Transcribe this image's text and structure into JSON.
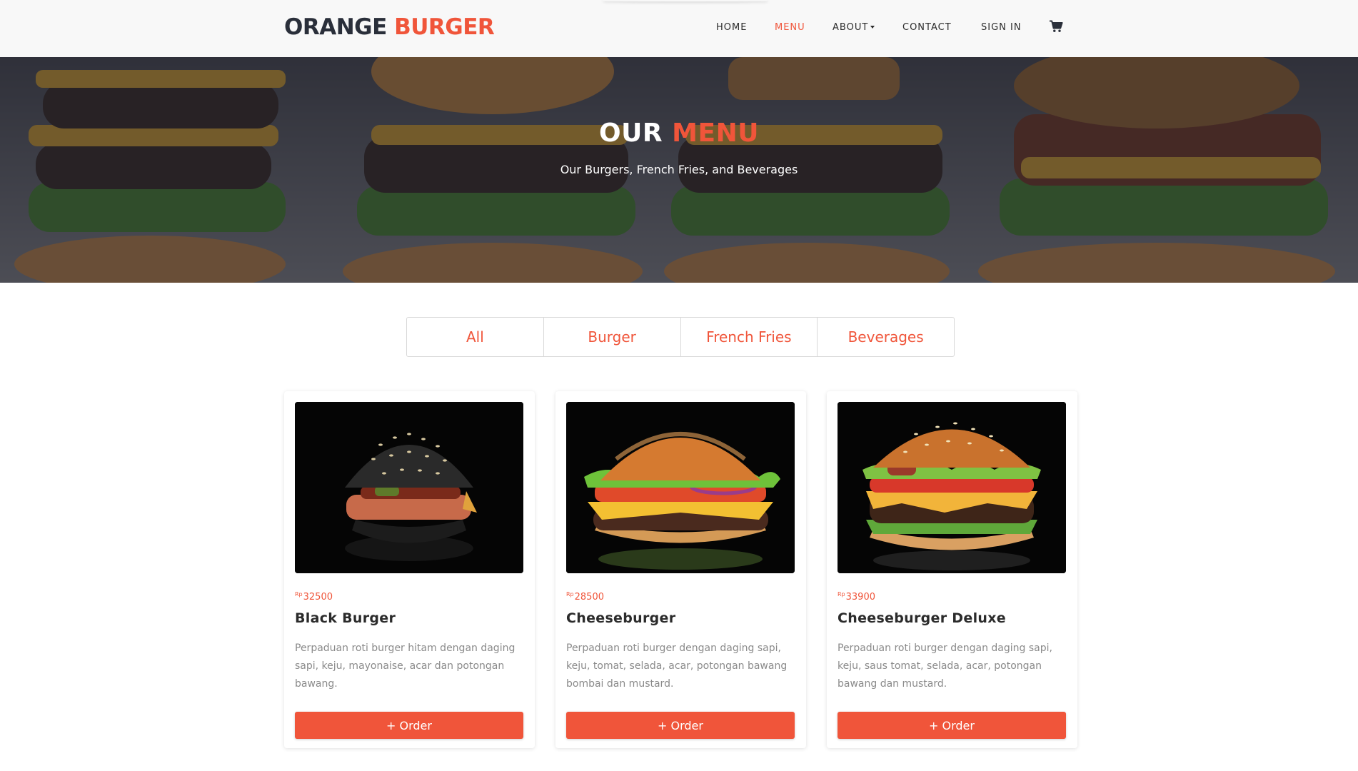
{
  "navbar": {
    "brand_part1": "ORANGE",
    "brand_part2": "BURGER",
    "items": [
      {
        "label": "HOME"
      },
      {
        "label": "MENU"
      },
      {
        "label": "ABOUT"
      },
      {
        "label": "CONTACT"
      },
      {
        "label": "SIGN IN"
      }
    ],
    "active_item": "MENU",
    "cart_icon": "shopping-cart-icon"
  },
  "hero": {
    "title_part1": "OUR",
    "title_part2": "MENU",
    "subtitle": "Our Burgers, French Fries, and Beverages"
  },
  "filters": {
    "tabs": [
      {
        "label": "All"
      },
      {
        "label": "Burger"
      },
      {
        "label": "French Fries"
      },
      {
        "label": "Beverages"
      }
    ]
  },
  "menu": {
    "currency": "Rp",
    "items": [
      {
        "price": "32500",
        "name": "Black Burger",
        "description": "Perpaduan roti burger hitam dengan daging sapi, keju, mayonaise, acar dan potongan bawang.",
        "order_label": "+ Order"
      },
      {
        "price": "28500",
        "name": "Cheeseburger",
        "description": "Perpaduan roti burger dengan daging sapi, keju, tomat, selada, acar, potongan bawang bombai dan mustard.",
        "order_label": "+ Order"
      },
      {
        "price": "33900",
        "name": "Cheeseburger Deluxe",
        "description": "Perpaduan roti burger dengan daging sapi, keju, saus tomat, selada, acar, potongan bawang dan mustard.",
        "order_label": "+ Order"
      }
    ]
  },
  "colors": {
    "accent": "#f0553a",
    "dark": "#2a2f3a",
    "navbar_bg": "#f8f8f8"
  }
}
